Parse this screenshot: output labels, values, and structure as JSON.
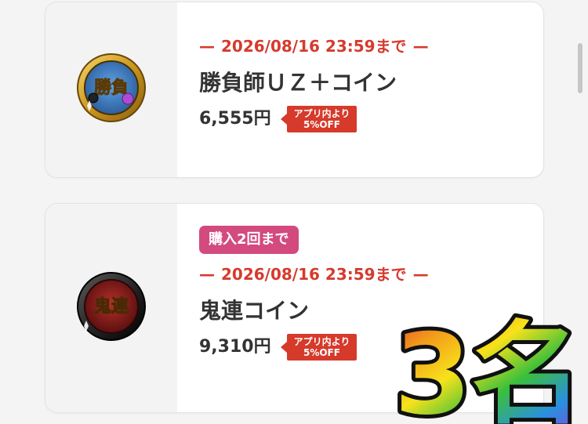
{
  "items": [
    {
      "deadline": "2026/08/16 23:59まで",
      "dash_left": "—",
      "dash_right": "—",
      "name": "勝負師ＵＺ＋コイン",
      "price": "6,555円",
      "discount_line1": "アプリ内より",
      "discount_line2": "5%OFF",
      "coin_icon_text": "勝負",
      "coin_colors": {
        "outer": "#caa427",
        "inner": "#3d7cc4"
      }
    },
    {
      "limit_badge": "購入2回まで",
      "deadline": "2026/08/16 23:59まで",
      "dash_left": "—",
      "dash_right": "—",
      "name": "鬼連コイン",
      "price": "9,310円",
      "discount_line1": "アプリ内より",
      "discount_line2": "5%OFF",
      "coin_icon_text": "鬼連",
      "coin_colors": {
        "outer": "#2c2c2c",
        "inner": "#8a1c1c"
      }
    }
  ],
  "overlay": {
    "rank_text": "3名",
    "colors": [
      "#e63b2e",
      "#f39c1a",
      "#f7e21b",
      "#3bbf3b",
      "#2a8fe0",
      "#8b3dd6"
    ]
  },
  "colors": {
    "accent_red": "#d53b2d",
    "badge_pink": "#d34a7f",
    "text_dark": "#333333"
  }
}
